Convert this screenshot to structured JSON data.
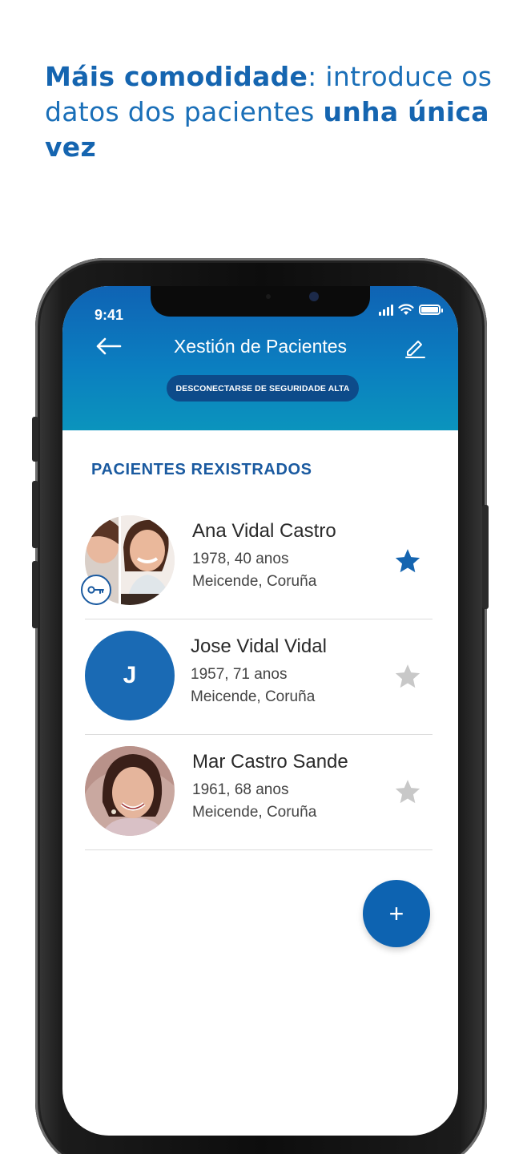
{
  "headline": {
    "part1_bold": "Máis comodidade",
    "part2": ": introduce os datos dos pacientes ",
    "part3_bold": "unha única vez"
  },
  "status_bar": {
    "time": "9:41"
  },
  "header": {
    "title": "Xestión de Pacientes",
    "logout_button": "DESCONECTARSE DE SEGURIDADE ALTA"
  },
  "section_title": "PACIENTES REXISTRADOS",
  "patients": [
    {
      "name": "Ana Vidal Castro",
      "info": "1978, 40 anos",
      "location": "Meicende, Coruña",
      "favorite": true,
      "avatar": "photo"
    },
    {
      "name": "Jose Vidal Vidal",
      "info": "1957, 71 anos",
      "location": "Meicende, Coruña",
      "favorite": false,
      "avatar": "initial",
      "initial": "J"
    },
    {
      "name": "Mar Castro Sande",
      "info": "1961, 68 anos",
      "location": "Meicende, Coruña",
      "favorite": false,
      "avatar": "photo"
    }
  ],
  "fab": {
    "label": "+"
  },
  "colors": {
    "brand_blue": "#1565b0",
    "header_top": "#0f63b4",
    "header_bottom": "#0b94bd",
    "star_active": "#1565b0",
    "star_inactive": "#c8c8c8"
  }
}
